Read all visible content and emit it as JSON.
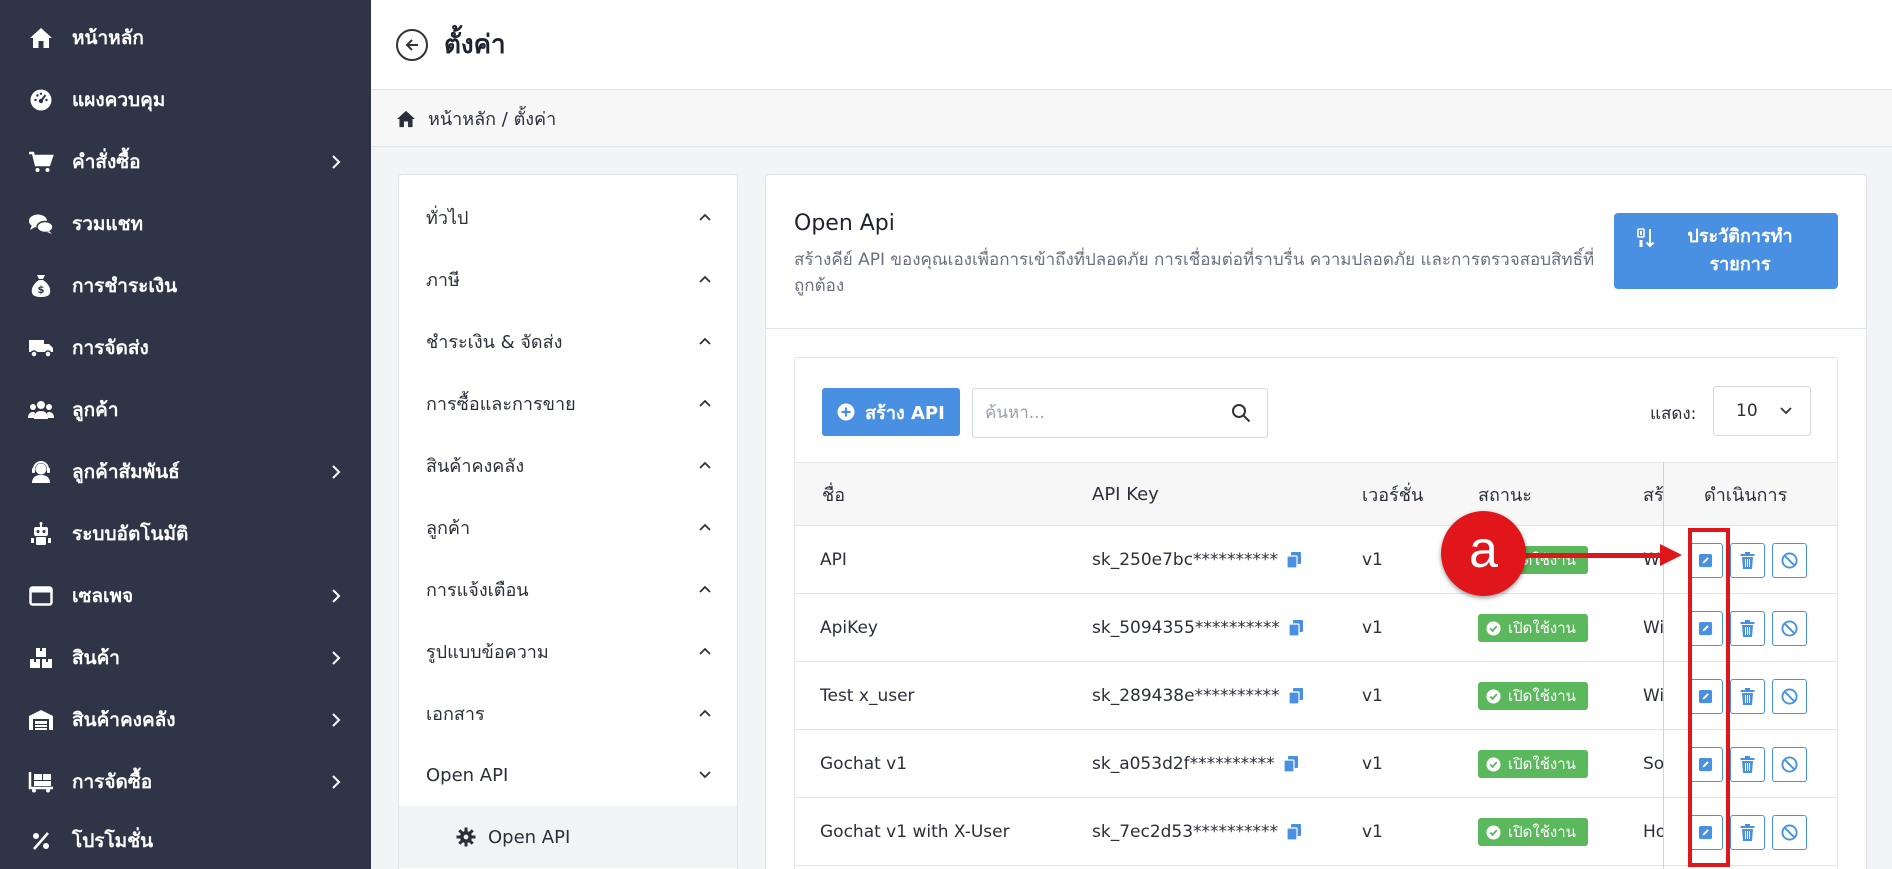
{
  "sidebar": {
    "items": [
      {
        "label": "หน้าหลัก",
        "icon": "home-icon",
        "has_submenu": false
      },
      {
        "label": "แผงควบคุม",
        "icon": "dashboard-icon",
        "has_submenu": false
      },
      {
        "label": "คำสั่งซื้อ",
        "icon": "cart-icon",
        "has_submenu": true
      },
      {
        "label": "รวมแชท",
        "icon": "chat-icon",
        "has_submenu": false
      },
      {
        "label": "การชำระเงิน",
        "icon": "money-bag-icon",
        "has_submenu": false
      },
      {
        "label": "การจัดส่ง",
        "icon": "truck-icon",
        "has_submenu": false
      },
      {
        "label": "ลูกค้า",
        "icon": "users-icon",
        "has_submenu": false
      },
      {
        "label": "ลูกค้าสัมพันธ์",
        "icon": "support-agent-icon",
        "has_submenu": true
      },
      {
        "label": "ระบบอัตโนมัติ",
        "icon": "robot-icon",
        "has_submenu": false
      },
      {
        "label": "เซลเพจ",
        "icon": "browser-window-icon",
        "has_submenu": true
      },
      {
        "label": "สินค้า",
        "icon": "boxes-icon",
        "has_submenu": true
      },
      {
        "label": "สินค้าคงคลัง",
        "icon": "warehouse-icon",
        "has_submenu": true
      },
      {
        "label": "การจัดซื้อ",
        "icon": "dolly-icon",
        "has_submenu": true
      },
      {
        "label": "โปรโมชั่น",
        "icon": "percent-icon",
        "has_submenu": false
      }
    ]
  },
  "header": {
    "title": "ตั้งค่า",
    "breadcrumb": "หน้าหลัก / ตั้งค่า"
  },
  "settings_menu": {
    "items": [
      {
        "label": "ทั่วไป",
        "expanded": false
      },
      {
        "label": "ภาษี",
        "expanded": false
      },
      {
        "label": "ชำระเงิน & จัดส่ง",
        "expanded": false
      },
      {
        "label": "การซื้อและการขาย",
        "expanded": false
      },
      {
        "label": "สินค้าคงคลัง",
        "expanded": false
      },
      {
        "label": "ลูกค้า",
        "expanded": false
      },
      {
        "label": "การแจ้งเตือน",
        "expanded": false
      },
      {
        "label": "รูปแบบข้อความ",
        "expanded": false
      },
      {
        "label": "เอกสาร",
        "expanded": false
      },
      {
        "label": "Open API",
        "expanded": true
      }
    ],
    "active_sub": "Open API"
  },
  "main": {
    "title": "Open Api",
    "description": "สร้างคีย์ API ของคุณเองเพื่อการเข้าถึงที่ปลอดภัย การเชื่อมต่อที่ราบรื่น ความปลอดภัย และการตรวจสอบสิทธิ์ที่ถูกต้อง",
    "history_button": "ประวัติการทำรายการ",
    "create_button": "สร้าง API",
    "search_placeholder": "ค้นหา...",
    "show_label": "แสดง:",
    "page_size": "10"
  },
  "table": {
    "columns": [
      "ชื่อ",
      "API Key",
      "เวอร์ชั่น",
      "สถานะ",
      "สร้",
      "ดำเนินการ"
    ],
    "rows": [
      {
        "name": "API",
        "key": "sk_250e7bc**********",
        "version": "v1",
        "status": "เปิดใช้งาน",
        "created": "Wi"
      },
      {
        "name": "ApiKey",
        "key": "sk_5094355**********",
        "version": "v1",
        "status": "เปิดใช้งาน",
        "created": "Wi"
      },
      {
        "name": "Test x_user",
        "key": "sk_289438e**********",
        "version": "v1",
        "status": "เปิดใช้งาน",
        "created": "Wi"
      },
      {
        "name": "Gochat v1",
        "key": "sk_a053d2f**********",
        "version": "v1",
        "status": "เปิดใช้งาน",
        "created": "So"
      },
      {
        "name": "Gochat v1 with X-User",
        "key": "sk_7ec2d53**********",
        "version": "v1",
        "status": "เปิดใช้งาน",
        "created": "Ho"
      }
    ]
  },
  "annotation": {
    "label": "a"
  },
  "colors": {
    "sidebar_bg": "#2f3446",
    "accent": "#4a90e2",
    "status_green": "#5cb85c",
    "annotation_red": "#e0161b"
  }
}
